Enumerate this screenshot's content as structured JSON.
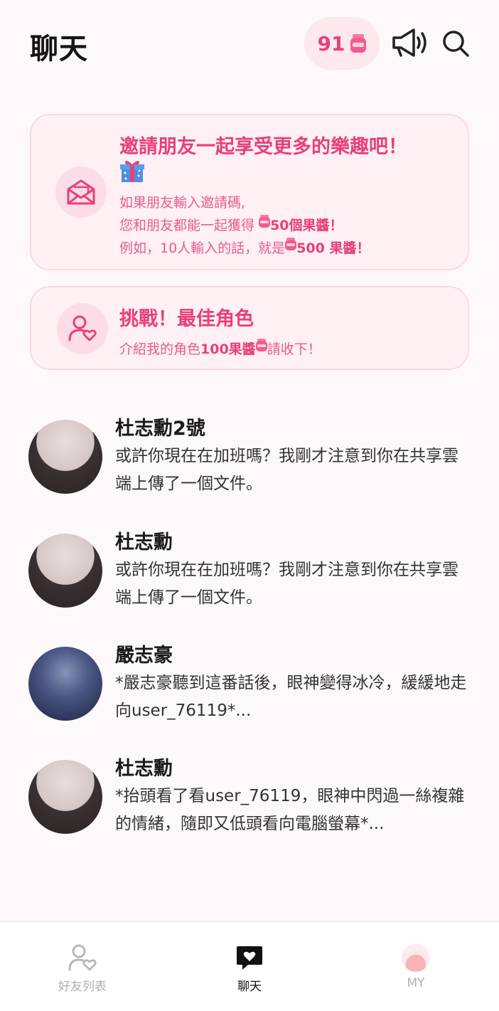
{
  "header": {
    "title": "聊天",
    "jam_count": "91",
    "icons": [
      "jam-jar-icon",
      "megaphone-icon",
      "search-icon"
    ]
  },
  "invite_card": {
    "title": "邀請朋友一起享受更多的樂趣吧！",
    "line1": "如果朋友輸入邀請碼,",
    "line2_pre": "您和朋友都能一起獲得",
    "line2_bold": "50個果醬！",
    "line3_pre": "例如，10人輸入的話，就是",
    "line3_bold": "500 果醬！",
    "icons": [
      "mail-icon",
      "gift-icon"
    ]
  },
  "challenge_card": {
    "title": "挑戰！最佳角色",
    "line_pre": "介紹我的角色",
    "line_bold": "100果醬",
    "line_post": "請收下！",
    "icons": [
      "user-heart-icon"
    ]
  },
  "chats": [
    {
      "name": "杜志勳2號",
      "message": "或許你現在在加班嗎？我剛才注意到你在共享雲端上傳了一個文件。"
    },
    {
      "name": "杜志勳",
      "message": "或許你現在在加班嗎？我剛才注意到你在共享雲端上傳了一個文件。"
    },
    {
      "name": "嚴志豪",
      "message": "*嚴志豪聽到這番話後，眼神變得冰冷，緩緩地走向user_76119*..."
    },
    {
      "name": "杜志勳",
      "message": "*抬頭看了看user_76119，眼神中閃過一絲複雜的情緒，隨即又低頭看向電腦螢幕*..."
    }
  ],
  "tabbar": {
    "items": [
      {
        "label": "好友列表",
        "active": false
      },
      {
        "label": "聊天",
        "active": true
      },
      {
        "label": "MY",
        "active": false
      }
    ]
  },
  "colors": {
    "accent": "#e8407a",
    "card_bg": "#fef0f3",
    "background": "#fdf8f9"
  }
}
